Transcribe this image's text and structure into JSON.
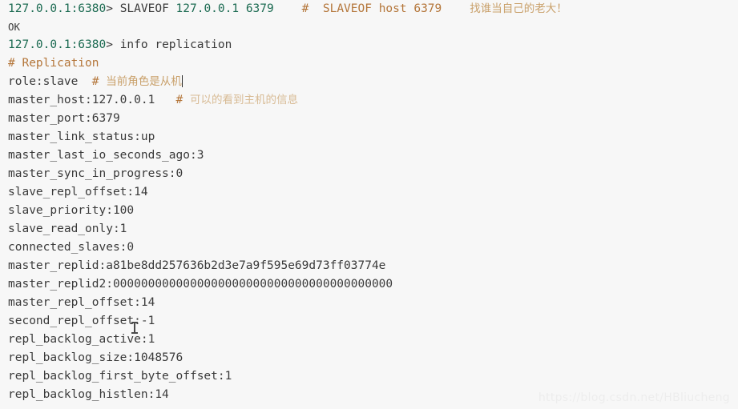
{
  "terminal": {
    "background_color": "#f7f7f7",
    "text_color": "#3a3a3a",
    "prompt_color": "#1c6b52",
    "comment_color": "#b4763a",
    "comment_cn_color": "#c9a06a",
    "prompt": "127.0.0.1:6380>",
    "prompt_ip": "127.0.0.1:6380",
    "prompt_symbol": ">"
  },
  "lines": {
    "l1_cmd_name": "SLAVEOF",
    "l1_cmd_args": "127.0.0.1 6379",
    "l1_comment": "#  SLAVEOF host 6379",
    "l1_comment_cn": "找谁当自己的老大！",
    "l2_reply": "OK",
    "l3_cmd": "info replication",
    "l4_section": "# Replication",
    "l5_key": "role:slave",
    "l5_comment": "#",
    "l5_comment_cn": "当前角色是从机",
    "l6_key": "master_host:127.0.0.1",
    "l6_comment": "#",
    "l6_comment_cn": "可以的看到主机的信息",
    "l7": "master_port:6379",
    "l8": "master_link_status:up",
    "l9": "master_last_io_seconds_ago:3",
    "l10": "master_sync_in_progress:0",
    "l11": "slave_repl_offset:14",
    "l12": "slave_priority:100",
    "l13": "slave_read_only:1",
    "l14": "connected_slaves:0",
    "l15": "master_replid:a81be8dd257636b2d3e7a9f595e69d73ff03774e",
    "l16": "master_replid2:0000000000000000000000000000000000000000",
    "l17": "master_repl_offset:14",
    "l18": "second_repl_offset:-1",
    "l19": "repl_backlog_active:1",
    "l20": "repl_backlog_size:1048576",
    "l21": "repl_backlog_first_byte_offset:1",
    "l22": "repl_backlog_histlen:14"
  },
  "watermark": {
    "text": "https://blog.csdn.net/HBliucheng"
  }
}
